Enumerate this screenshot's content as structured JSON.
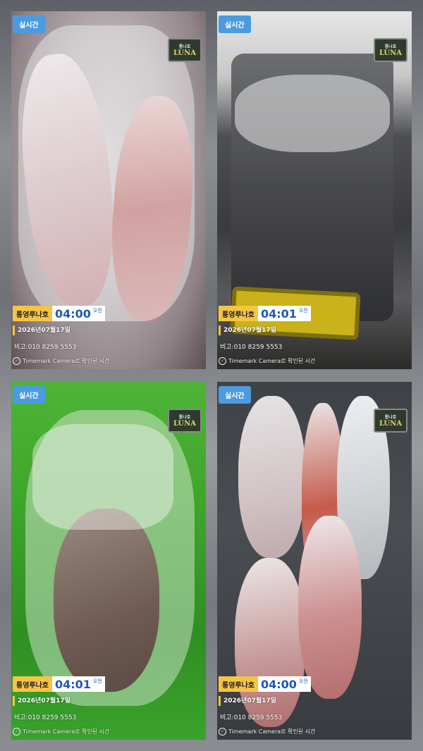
{
  "photos": [
    {
      "badge": "실시간",
      "logo": "LUNA",
      "logo_small": "통나호",
      "boat": "통영루나호",
      "time": "04:00",
      "ampm": "오전",
      "date": "2026년07월17일",
      "memo": "비고:010 8259 5553",
      "verify": "Timemark Camera로 확인된 시간",
      "scene": "squid-in-plastic-bags"
    },
    {
      "badge": "실시간",
      "logo": "LUNA",
      "logo_small": "통나호",
      "boat": "통영루나호",
      "time": "04:01",
      "ampm": "오전",
      "date": "2026년07월17일",
      "memo": "비고:010 8259 5553",
      "verify": "Timemark Camera로 확인된 시간",
      "scene": "cooler-box-with-bagged-squid"
    },
    {
      "badge": "실시간",
      "logo": "LUNA",
      "logo_small": "통나호",
      "boat": "통영루나호",
      "time": "04:01",
      "ampm": "오전",
      "date": "2026년07월17일",
      "memo": "비고:010 8259 5553",
      "verify": "Timemark Camera로 확인된 시간",
      "scene": "squid-in-green-bag"
    },
    {
      "badge": "실시간",
      "logo": "LUNA",
      "logo_small": "통나호",
      "boat": "통영루나호",
      "time": "04:00",
      "ampm": "오전",
      "date": "2026년07월17일",
      "memo": "비고:010 8259 5553",
      "verify": "Timemark Camera로 확인된 시간",
      "scene": "squid-in-dark-cooler"
    }
  ],
  "colors": {
    "badge": "#4a9be2",
    "boat_label": "#f6c445",
    "clock": "#1d58b8"
  }
}
